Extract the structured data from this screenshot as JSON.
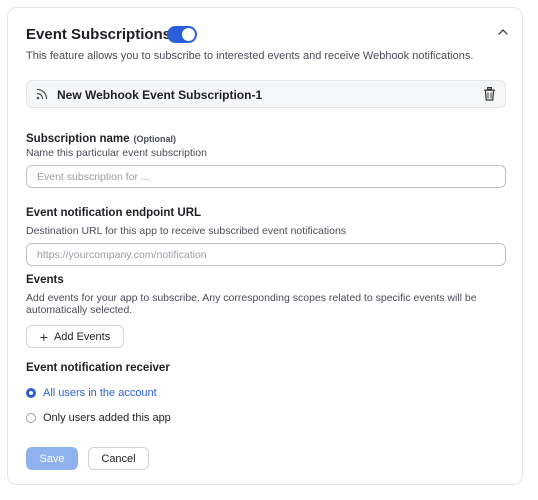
{
  "header": {
    "title": "Event Subscriptions",
    "toggle_on": true,
    "description": "This feature allows you to subscribe to interested events and receive Webhook notifications."
  },
  "subscription": {
    "name": "New Webhook Event Subscription-1",
    "rss_icon": "rss-icon",
    "delete_icon": "trash-icon"
  },
  "subscription_name": {
    "label": "Subscription name",
    "optional": "(Optional)",
    "hint": "Name this particular event subscription",
    "placeholder": "Event subscription for ...",
    "value": ""
  },
  "endpoint": {
    "label": "Event notification endpoint URL",
    "hint": "Destination URL for this app to receive subscribed event notifications",
    "placeholder": "https://yourcompany.com/notification",
    "value": ""
  },
  "events": {
    "label": "Events",
    "hint_line1": "Add events for your app to subscribe. Any corresponding scopes related to specific events will be",
    "hint_line2": "automatically selected.",
    "add_button": "Add Events"
  },
  "receiver": {
    "label": "Event notification receiver",
    "options": [
      {
        "label": "All users in the account",
        "selected": true
      },
      {
        "label": "Only users added this app",
        "selected": false
      }
    ]
  },
  "actions": {
    "save": "Save",
    "cancel": "Cancel"
  },
  "colors": {
    "accent": "#2b5fd9",
    "save_disabled": "#8fb2ef",
    "selected_text": "#2b5fd9"
  }
}
